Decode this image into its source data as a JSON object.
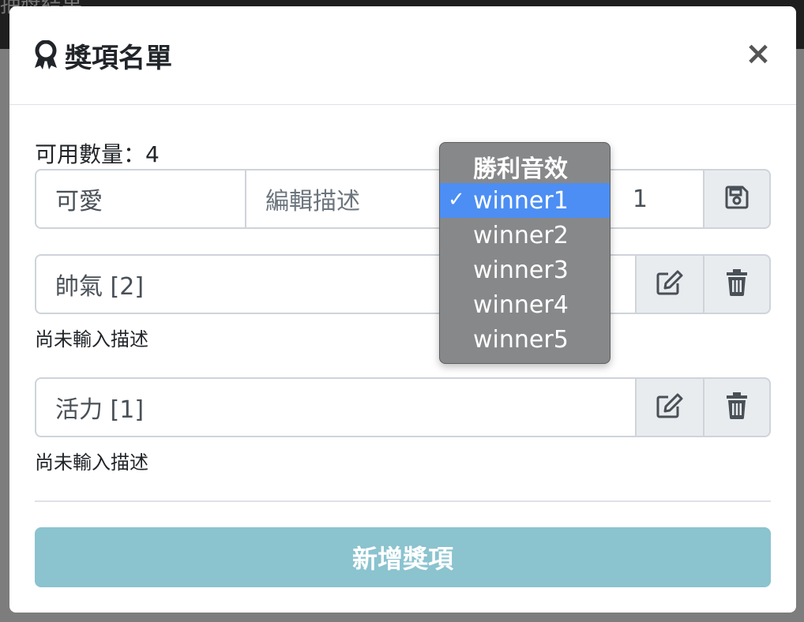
{
  "background": {
    "title_fragment": "抽獎結果"
  },
  "modal": {
    "title": "獎項名單",
    "title_icon": "award-icon",
    "close_label": "×"
  },
  "available": {
    "text": "可用數量：4"
  },
  "edit_row": {
    "name_value": "可愛",
    "description_placeholder": "編輯描述",
    "quantity_value": "1",
    "save_icon": "save-icon"
  },
  "prizes": [
    {
      "label": "帥氣 [2]",
      "description": "尚未輸入描述"
    },
    {
      "label": "活力 [1]",
      "description": "尚未輸入描述"
    }
  ],
  "add_button": {
    "label": "新增獎項"
  },
  "sound_dropdown": {
    "header": "勝利音效",
    "selected": "winner1",
    "check_mark": "✓",
    "options": [
      "winner1",
      "winner2",
      "winner3",
      "winner4",
      "winner5"
    ]
  },
  "colors": {
    "selected_option": "#4c8ef3",
    "add_button": "#8bc3cf",
    "dropdown_bg": "#87888a"
  }
}
